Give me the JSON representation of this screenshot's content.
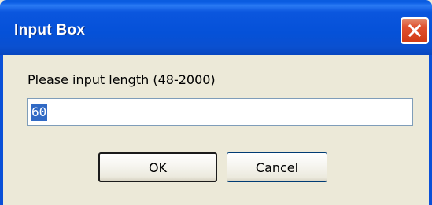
{
  "window": {
    "title": "Input Box"
  },
  "titlebar": {
    "close_icon": "close-icon"
  },
  "dialog": {
    "prompt": "Please input length (48-2000)",
    "input_value": "60",
    "ok_label": "OK",
    "cancel_label": "Cancel"
  },
  "colors": {
    "titlebar": "#0551d8",
    "close_button": "#e0512f",
    "selection": "#316ac5",
    "window_bg": "#ece9d8"
  }
}
